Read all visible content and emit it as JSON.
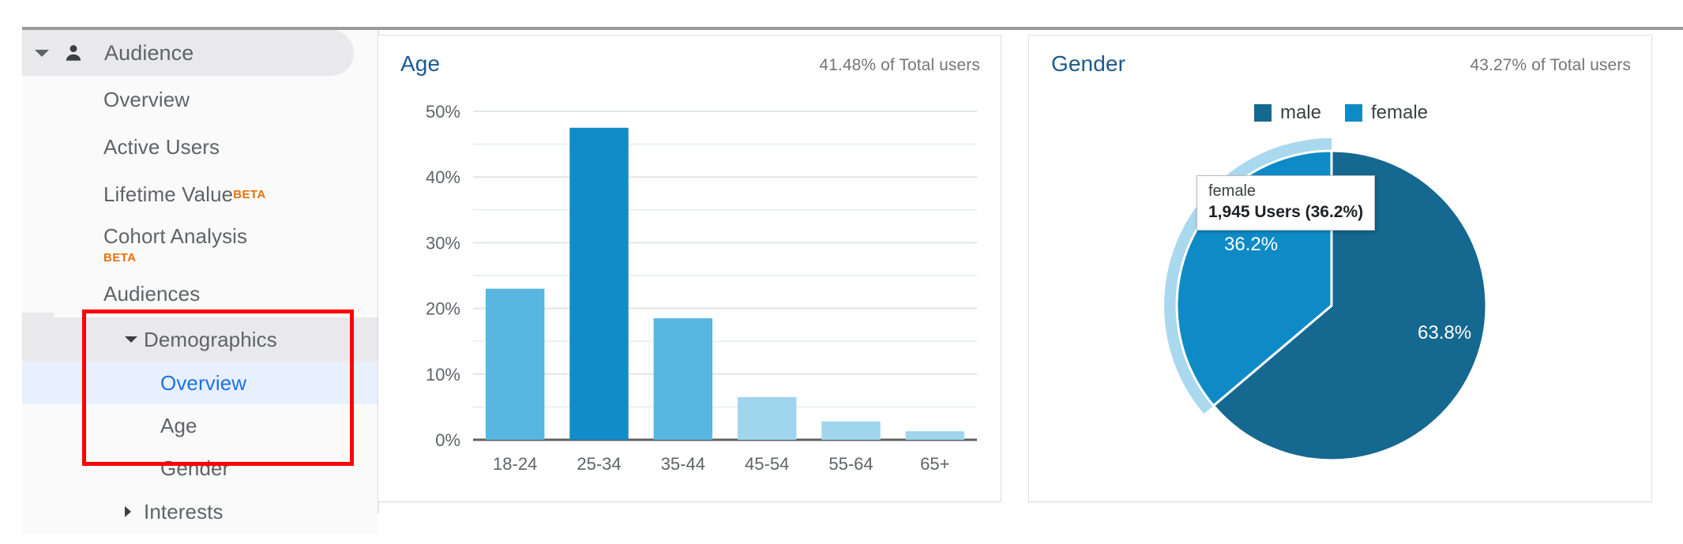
{
  "sidebar": {
    "header": {
      "label": "Audience",
      "icon": "person-icon",
      "caret": "caret-down-icon"
    },
    "items": [
      {
        "label": "Overview",
        "badge": ""
      },
      {
        "label": "Active Users",
        "badge": ""
      },
      {
        "label": "Lifetime Value",
        "badge": "BETA",
        "badge_position": "super"
      },
      {
        "label": "Cohort Analysis",
        "badge": "BETA",
        "badge_position": "below"
      },
      {
        "label": "Audiences",
        "badge": ""
      }
    ],
    "groups": [
      {
        "label": "Demographics",
        "expanded": true,
        "caret": "caret-down-icon",
        "children": [
          {
            "label": "Overview",
            "active": true
          },
          {
            "label": "Age",
            "active": false
          },
          {
            "label": "Gender",
            "active": false
          }
        ]
      },
      {
        "label": "Interests",
        "expanded": false,
        "caret": "caret-right-icon",
        "children": []
      }
    ],
    "annotation": {
      "color": "#ff0000",
      "shape": "rectangle"
    }
  },
  "colors": {
    "accent_blue": "#1a73e8",
    "card_title": "#1a5a8f",
    "bar_light": "#58b6e0",
    "bar_dark": "#108cc8",
    "pie_male": "#15688f",
    "pie_female": "#0e8bc7",
    "pie_highlight": "#a9d8ef",
    "beta_orange": "#e8710a",
    "annotation_red": "#ff0000"
  },
  "age_card": {
    "title": "Age",
    "subtitle": "41.48% of Total users"
  },
  "gender_card": {
    "title": "Gender",
    "subtitle": "43.27% of Total users",
    "legend": [
      {
        "label": "male",
        "color": "#15688f"
      },
      {
        "label": "female",
        "color": "#0e8bc7"
      }
    ],
    "tooltip": {
      "title": "female",
      "value": "1,945 Users (36.2%)"
    }
  },
  "chart_data": [
    {
      "type": "bar",
      "title": "Age",
      "subtitle": "41.48% of Total users",
      "categories": [
        "18-24",
        "25-34",
        "35-44",
        "45-54",
        "55-64",
        "65+"
      ],
      "values": [
        23.0,
        47.5,
        18.5,
        6.5,
        2.8,
        1.3
      ],
      "bar_colors": [
        "#58b6e0",
        "#108cc8",
        "#58b6e0",
        "#9fd6ee",
        "#9fd6ee",
        "#9fd6ee"
      ],
      "xlabel": "",
      "ylabel": "",
      "ylim": [
        0,
        50
      ],
      "yticks": [
        0,
        10,
        20,
        30,
        40,
        50
      ],
      "ytick_labels": [
        "0%",
        "10%",
        "20%",
        "30%",
        "40%",
        "50%"
      ],
      "grid": true,
      "legend": "none"
    },
    {
      "type": "pie",
      "title": "Gender",
      "subtitle": "43.27% of Total users",
      "categories": [
        "male",
        "female"
      ],
      "values": [
        63.8,
        36.2
      ],
      "value_labels": [
        "63.8%",
        "36.2%"
      ],
      "counts": [
        null,
        1945
      ],
      "colors": [
        "#15688f",
        "#0e8bc7"
      ],
      "legend": "top",
      "highlighted_slice": "female",
      "annotation": "female\n1,945 Users (36.2%)"
    }
  ]
}
